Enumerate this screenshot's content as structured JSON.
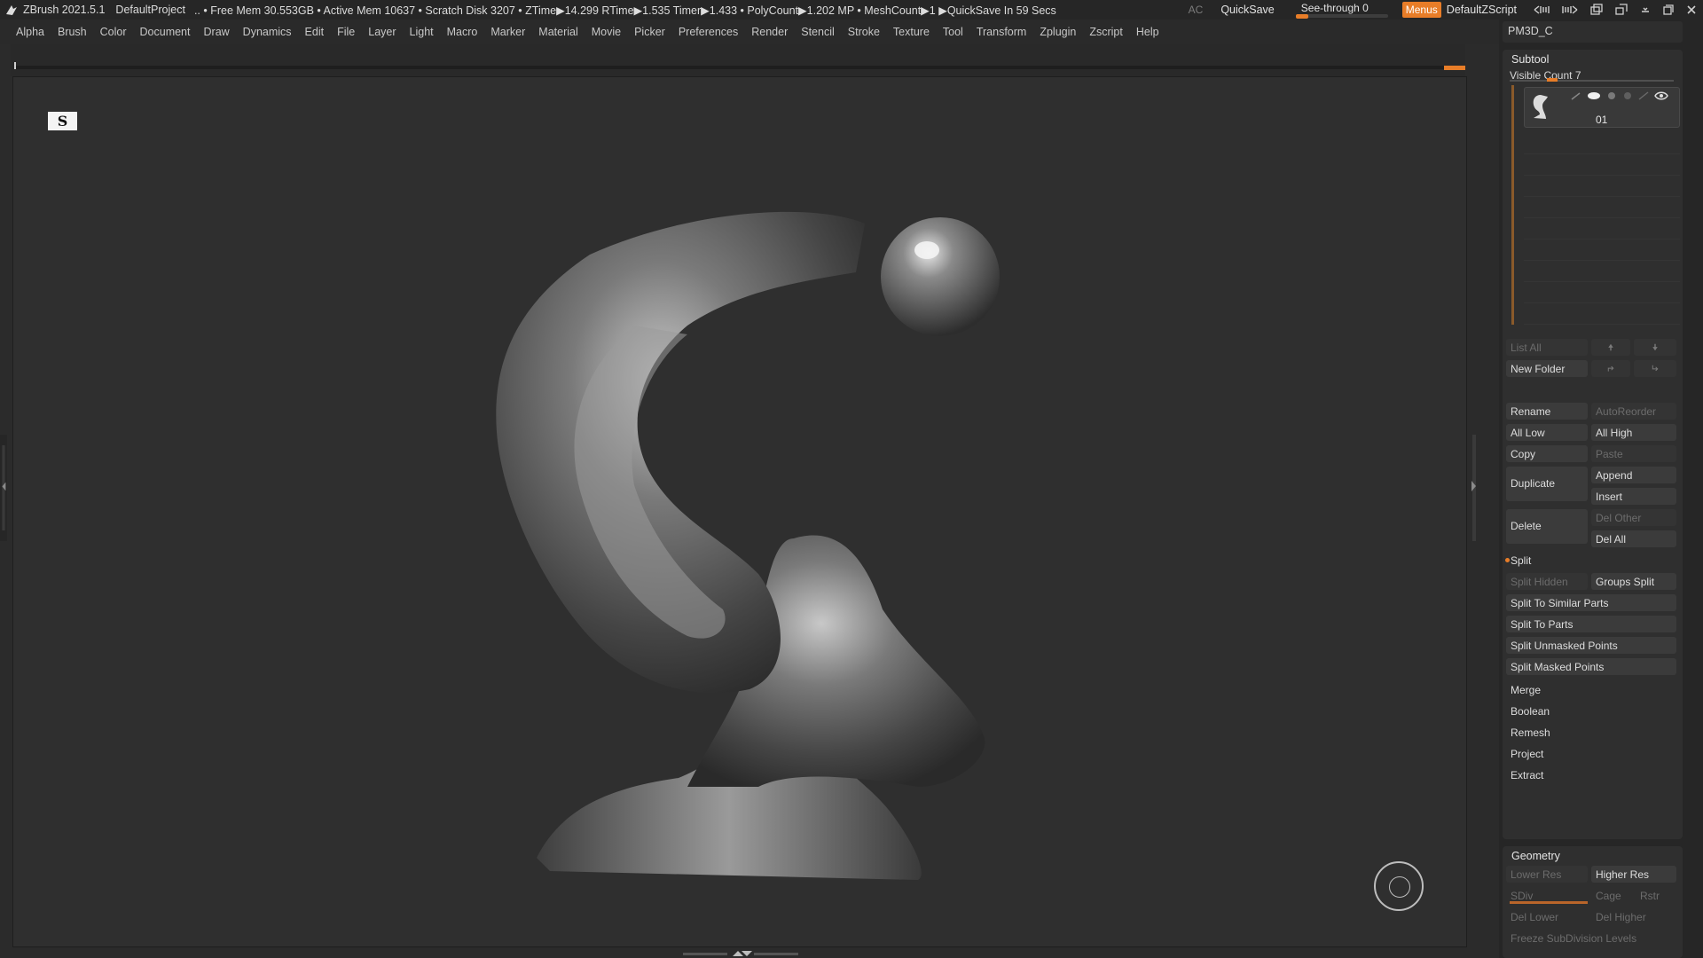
{
  "titlebar": {
    "app": "ZBrush 2021.5.1",
    "project": "DefaultProject",
    "stats": "..  • Free Mem 30.553GB • Active Mem 10637 • Scratch Disk 3207 •  ZTime▶14.299 RTime▶1.535 Timer▶1.433 • PolyCount▶1.202 MP  • MeshCount▶1  ▶QuickSave In 59 Secs",
    "ac": "AC",
    "quicksave": "QuickSave",
    "see_through": "See-through   0",
    "see_through_value": 0,
    "menus": "Menus",
    "default_zscript": "DefaultZScript",
    "accent_color": "#e87d28"
  },
  "menubar": [
    "Alpha",
    "Brush",
    "Color",
    "Document",
    "Draw",
    "Dynamics",
    "Edit",
    "File",
    "Layer",
    "Light",
    "Macro",
    "Marker",
    "Material",
    "Movie",
    "Picker",
    "Preferences",
    "Render",
    "Stencil",
    "Stroke",
    "Texture",
    "Tool",
    "Transform",
    "Zplugin",
    "Zscript",
    "Help"
  ],
  "canvas": {
    "badge": "S",
    "model_icon": "sculpted-model-icon"
  },
  "panel": {
    "tool_name": "PM3D_C",
    "subtool": {
      "title": "Subtool",
      "visible_count": "Visible Count 7",
      "item_number": "01",
      "list_all": "List All",
      "new_folder": "New Folder",
      "rename": "Rename",
      "auto_reorder": "AutoReorder",
      "all_low": "All Low",
      "all_high": "All High",
      "copy": "Copy",
      "paste": "Paste",
      "duplicate": "Duplicate",
      "append": "Append",
      "insert": "Insert",
      "delete": "Delete",
      "del_other": "Del Other",
      "del_all": "Del All",
      "split": "Split",
      "split_hidden": "Split Hidden",
      "groups_split": "Groups Split",
      "split_similar": "Split To Similar Parts",
      "split_parts": "Split To Parts",
      "split_unmasked": "Split Unmasked Points",
      "split_masked": "Split Masked Points",
      "merge": "Merge",
      "boolean": "Boolean",
      "remesh": "Remesh",
      "project": "Project",
      "extract": "Extract"
    },
    "geometry": {
      "title": "Geometry",
      "lower_res": "Lower Res",
      "higher_res": "Higher Res",
      "sdiv": "SDiv",
      "cage": "Cage",
      "rstr": "Rstr",
      "del_lower": "Del Lower",
      "del_higher": "Del Higher",
      "freeze": "Freeze SubDivision Levels"
    }
  }
}
